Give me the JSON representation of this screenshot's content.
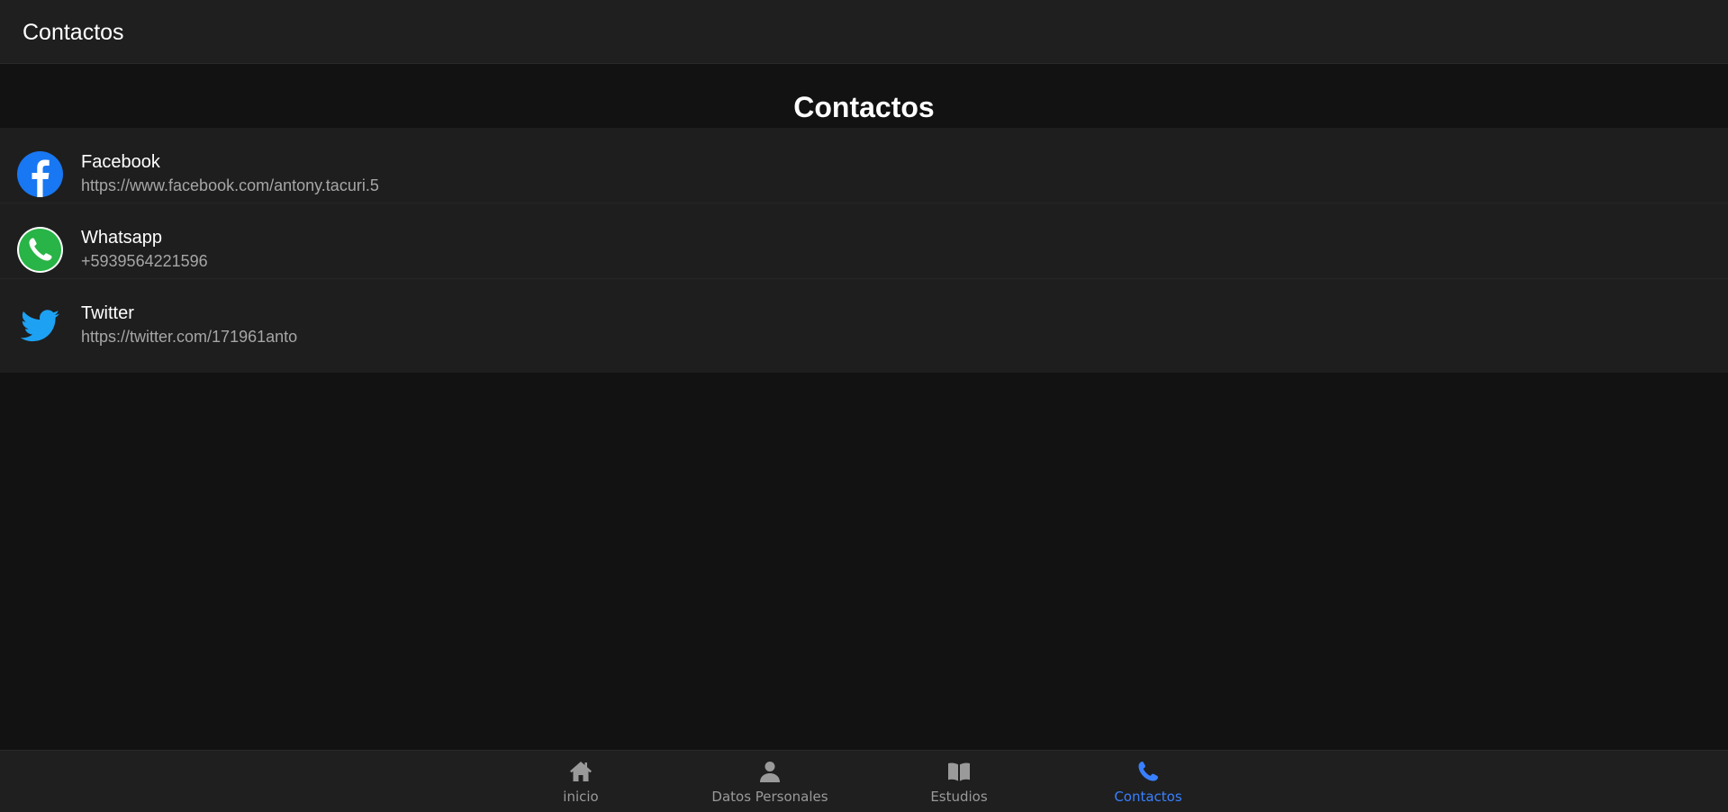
{
  "toolbar": {
    "title": "Contactos"
  },
  "page": {
    "heading": "Contactos"
  },
  "contacts": [
    {
      "name": "Facebook",
      "detail": "https://www.facebook.com/antony.tacuri.5",
      "icon": "facebook-icon",
      "color": "#1877f2"
    },
    {
      "name": "Whatsapp",
      "detail": "+5939564221596",
      "icon": "whatsapp-icon",
      "color": "#28b446"
    },
    {
      "name": "Twitter",
      "detail": "https://twitter.com/171961anto",
      "icon": "twitter-icon",
      "color": "#1da1f2"
    }
  ],
  "tabs": [
    {
      "label": "inicio",
      "icon": "home-icon",
      "active": false
    },
    {
      "label": "Datos Personales",
      "icon": "person-icon",
      "active": false
    },
    {
      "label": "Estudios",
      "icon": "book-icon",
      "active": false
    },
    {
      "label": "Contactos",
      "icon": "phone-icon",
      "active": true
    }
  ],
  "colors": {
    "background": "#121212",
    "toolbar": "#1f1f1f",
    "list_background": "#1e1e1e",
    "active_tab": "#3880ff",
    "inactive_tab": "#9a9a9a",
    "secondary_text": "#a6a6a6"
  }
}
